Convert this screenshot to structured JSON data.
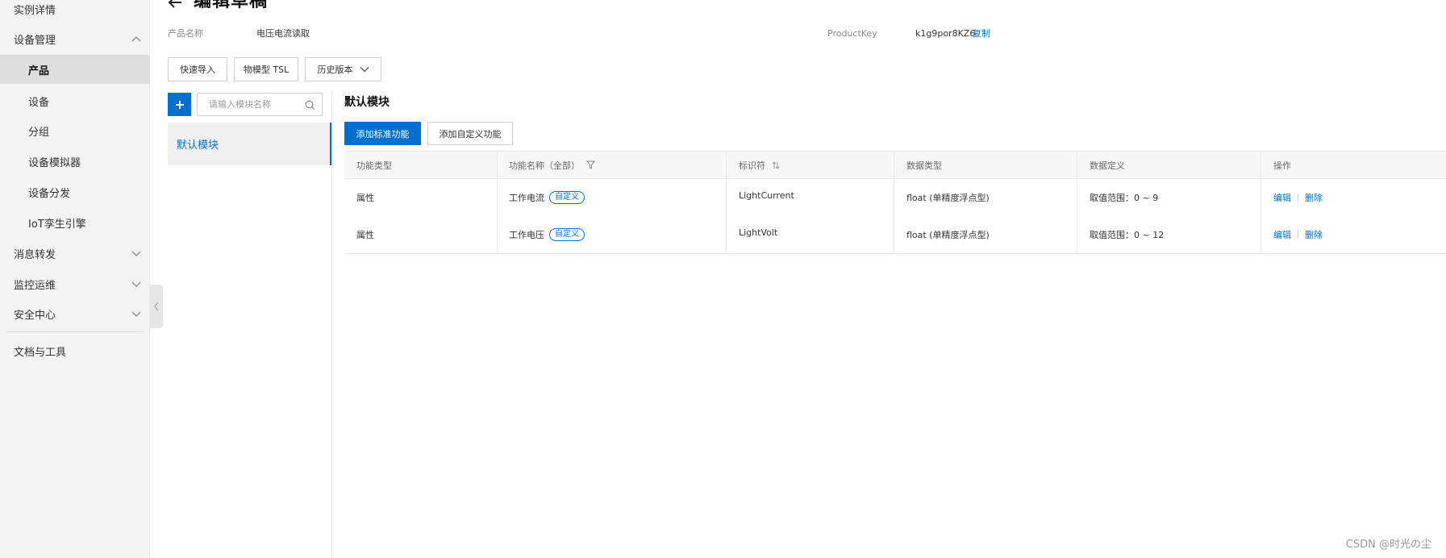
{
  "sidebar": {
    "items": [
      {
        "label": "实例详情",
        "level": "top",
        "state": "normal"
      },
      {
        "label": "设备管理",
        "level": "top",
        "state": "expanded"
      },
      {
        "label": "产品",
        "level": "sub",
        "state": "active"
      },
      {
        "label": "设备",
        "level": "sub",
        "state": "normal"
      },
      {
        "label": "分组",
        "level": "sub",
        "state": "normal"
      },
      {
        "label": "设备模拟器",
        "level": "sub",
        "state": "normal"
      },
      {
        "label": "设备分发",
        "level": "sub",
        "state": "normal"
      },
      {
        "label": "IoT孪生引擎",
        "level": "sub",
        "state": "normal"
      },
      {
        "label": "消息转发",
        "level": "top",
        "state": "collapsed"
      },
      {
        "label": "监控运维",
        "level": "top",
        "state": "collapsed"
      },
      {
        "label": "安全中心",
        "level": "top",
        "state": "collapsed"
      },
      {
        "label": "文档与工具",
        "level": "top",
        "state": "normal"
      }
    ]
  },
  "header": {
    "title": "编辑草稿",
    "product_name_label": "产品名称",
    "product_name": "电压电流读取",
    "product_key_label": "ProductKey",
    "product_key": "k1g9por8KZ6",
    "copy_label": "复制"
  },
  "toolbar": {
    "quick_import": "快速导入",
    "tsl": "物模型 TSL",
    "history": "历史版本"
  },
  "modules": {
    "search_placeholder": "请输入模块名称",
    "items": [
      "默认模块"
    ]
  },
  "main": {
    "section_title": "默认模块",
    "add_standard": "添加标准功能",
    "add_custom": "添加自定义功能",
    "columns": [
      "功能类型",
      "功能名称（全部）",
      "标识符",
      "数据类型",
      "数据定义",
      "操作"
    ],
    "rows": [
      {
        "type": "属性",
        "name": "工作电流",
        "tag": "自定义",
        "identifier": "LightCurrent",
        "data_type": "float (单精度浮点型)",
        "definition": "取值范围：0 ~ 9",
        "edit": "编辑",
        "delete": "删除"
      },
      {
        "type": "属性",
        "name": "工作电压",
        "tag": "自定义",
        "identifier": "LightVolt",
        "data_type": "float (单精度浮点型)",
        "definition": "取值范围：0 ~ 12",
        "edit": "编辑",
        "delete": "删除"
      }
    ]
  },
  "watermark": "CSDN @时光の尘",
  "colors": {
    "accent": "#0070cc",
    "sidebar_bg": "#f3f3f3",
    "active_bg": "#dedede"
  }
}
